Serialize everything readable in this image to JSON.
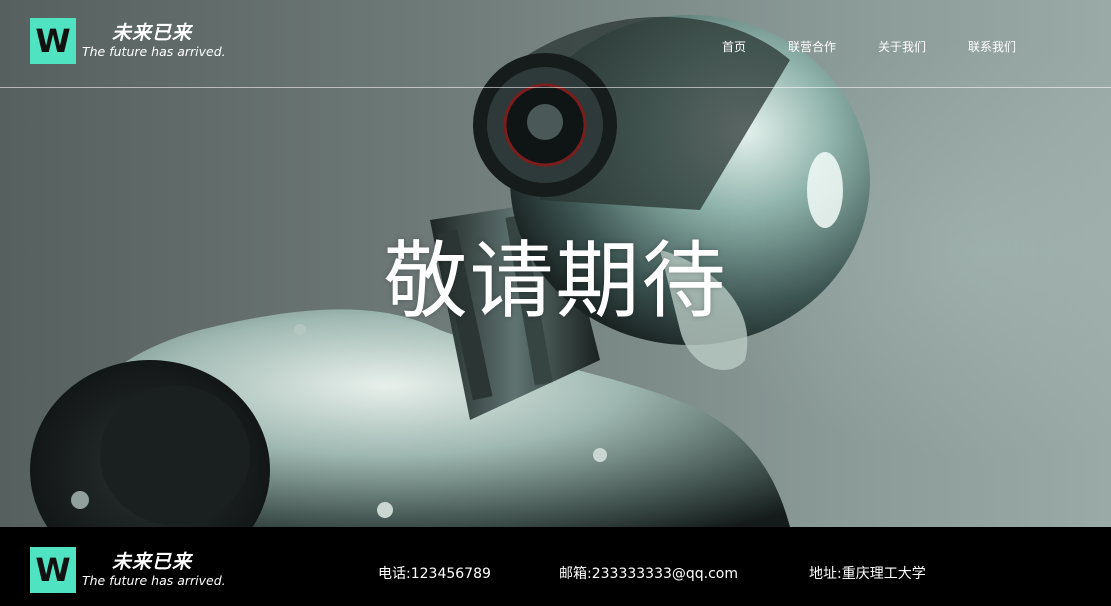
{
  "brand": {
    "logo_letter": "W",
    "name_cn": "未来已来",
    "tagline": "The future has arrived.",
    "accent_color": "#4fe3c1"
  },
  "nav": {
    "items": [
      {
        "label": "首页"
      },
      {
        "label": "联营合作"
      },
      {
        "label": "关于我们"
      },
      {
        "label": "联系我们"
      }
    ]
  },
  "hero": {
    "headline": "敬请期待"
  },
  "footer": {
    "phone": "电话:123456789",
    "email": "邮箱:233333333@qq.com",
    "address": "地址:重庆理工大学"
  }
}
